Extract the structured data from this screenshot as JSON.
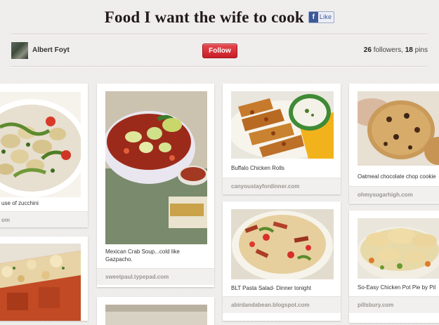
{
  "board": {
    "title": "Food I want the wife to cook",
    "fb_like": "Like",
    "fb_icon": "facebook-f-icon"
  },
  "user": {
    "name": "Albert Foyt",
    "follow_label": "Follow",
    "followers": "26",
    "followers_label": "followers,",
    "pins": "18",
    "pins_label": "pins"
  },
  "pins": [
    {
      "description": "use of zucchini",
      "source": "om"
    },
    {
      "description": "Mexican Crab Soup...cold like",
      "description2": "Gazpacho.",
      "source": "sweetpaul.typepad.com"
    },
    {
      "description": "Buffalo Chicken Rolls",
      "source": "canyoustayfordinner.com"
    },
    {
      "description": "Oatmeal chocolate chop cookie",
      "source": "ohmysugarhigh.com"
    },
    {
      "description": "BLT Pasta Salad- Dinner tonight",
      "source": "abirdandabean.blogspot.com"
    },
    {
      "description": "So-Easy Chicken Pot Pie by Pil",
      "source": "pillsbury.com"
    }
  ],
  "colors": {
    "accent": "#cb2027",
    "background": "#f1efed"
  }
}
